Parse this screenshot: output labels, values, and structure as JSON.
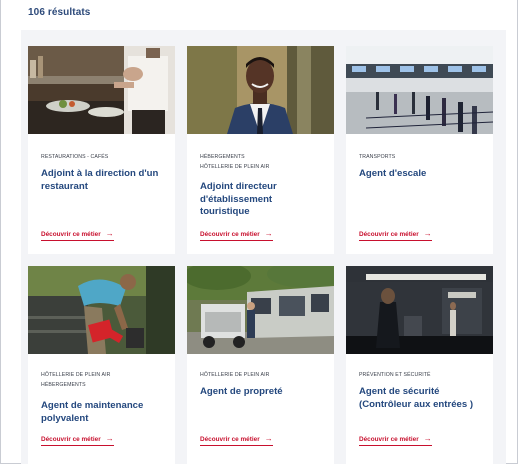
{
  "results": {
    "count_label": "106 résultats"
  },
  "cards": [
    {
      "categories": [
        "RESTAURATIONS - CAFÉS"
      ],
      "title_lines": [
        "Adjoint à la direction d'un",
        "restaurant"
      ],
      "link": "Découvrir ce métier",
      "arrow": "→"
    },
    {
      "categories": [
        "HÉBERGEMENTS",
        "HÔTELLERIE DE PLEIN AIR"
      ],
      "title_lines": [
        "Adjoint directeur",
        "d'établissement",
        "touristique"
      ],
      "link": "Découvrir ce métier",
      "arrow": "→"
    },
    {
      "categories": [
        "TRANSPORTS"
      ],
      "title_lines": [
        "Agent d'escale"
      ],
      "link": "Découvrir ce métier",
      "arrow": "→"
    },
    {
      "categories": [
        "HÔTELLERIE DE PLEIN AIR",
        "HÉBERGEMENTS"
      ],
      "title_lines": [
        "Agent de maintenance",
        "polyvalent"
      ],
      "link": "Découvrir ce métier",
      "arrow": "→"
    },
    {
      "categories": [
        "HÔTELLERIE DE PLEIN AIR"
      ],
      "title_lines": [
        "Agent de propreté"
      ],
      "link": "Découvrir ce métier",
      "arrow": "→"
    },
    {
      "categories": [
        "PRÉVENTION ET SÉCURITÉ"
      ],
      "title_lines": [
        "Agent de sécurité",
        "(Contrôleur aux entrées )"
      ],
      "link": "Découvrir ce métier",
      "arrow": "→"
    }
  ],
  "colors": {
    "title": "#24487e",
    "link": "#c8102e",
    "background": "#f3f4f7"
  }
}
